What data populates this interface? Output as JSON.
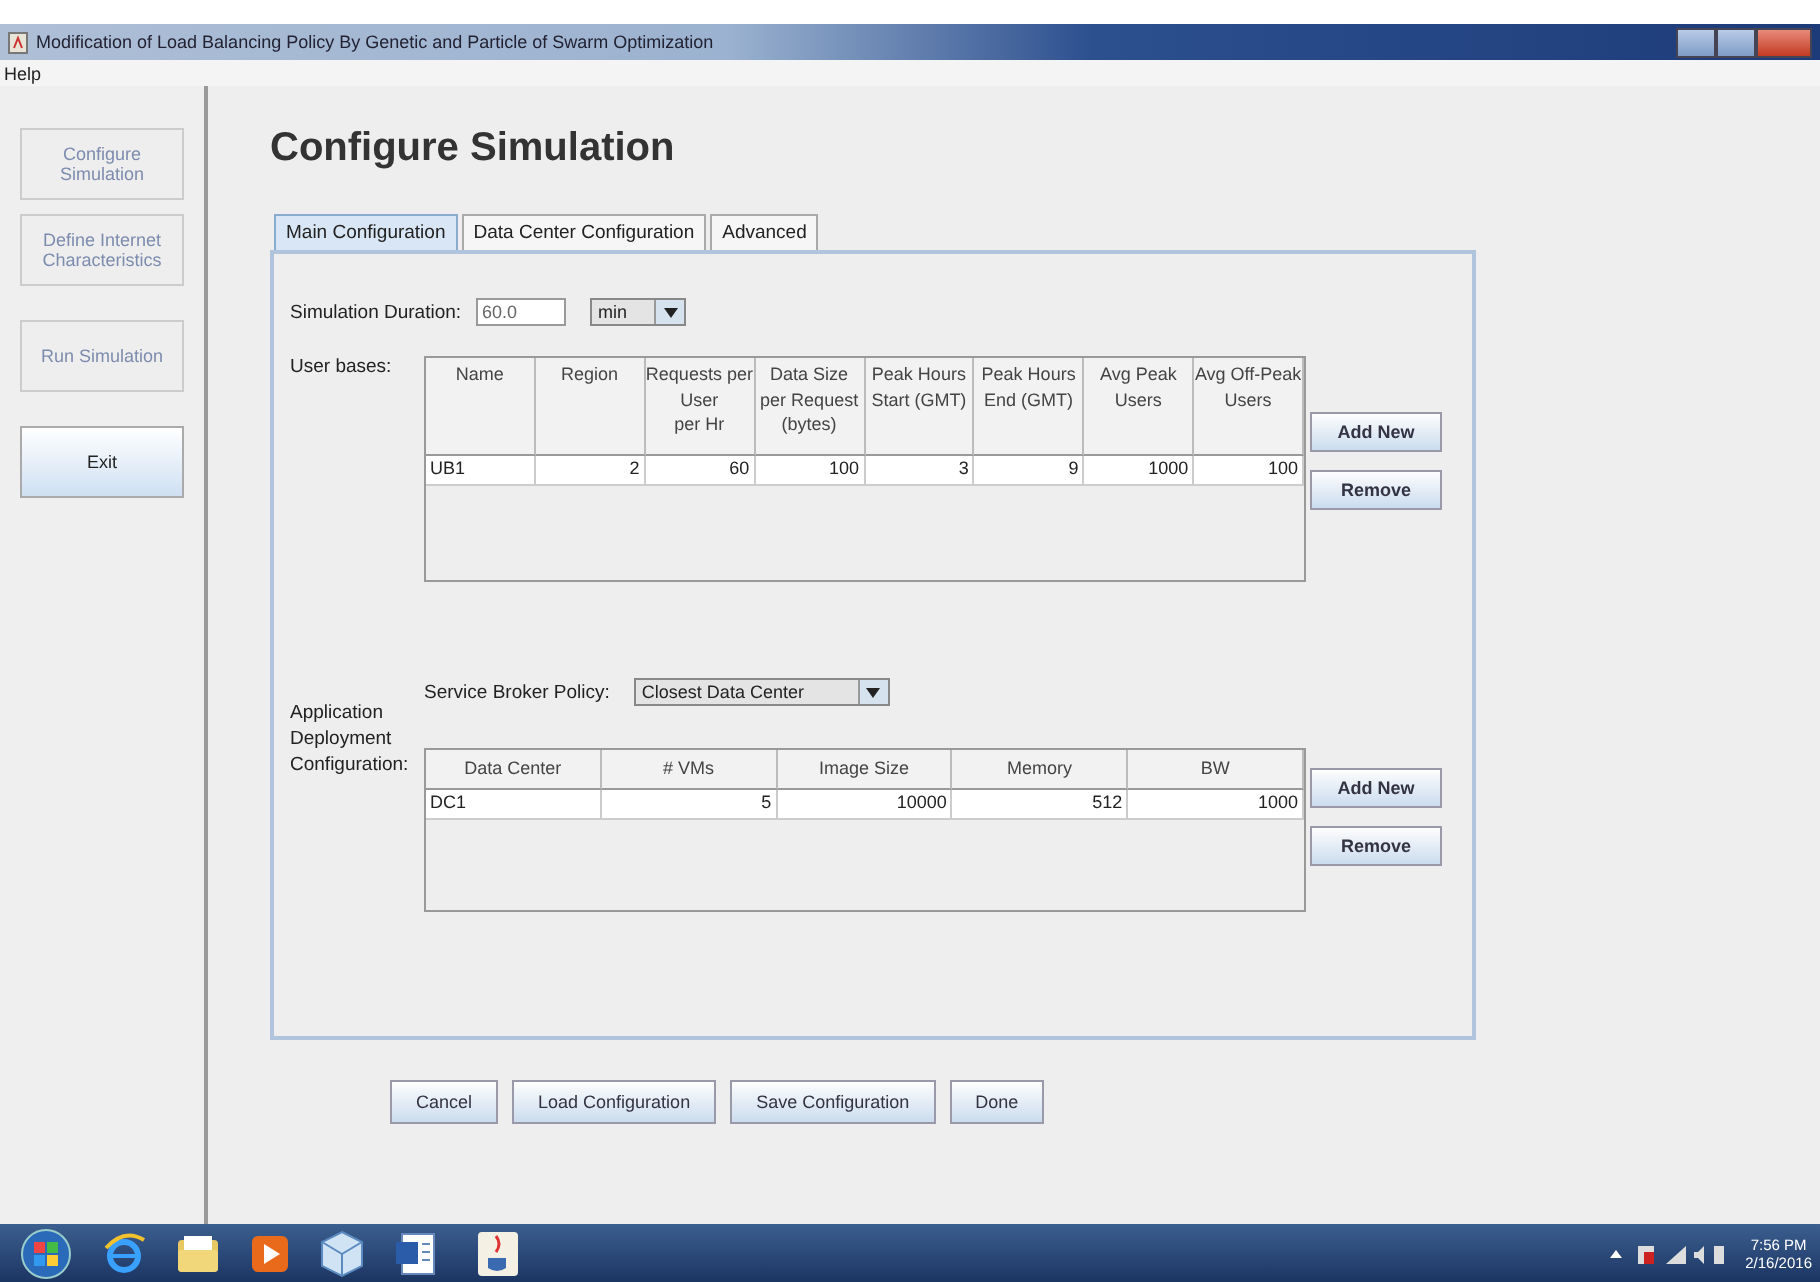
{
  "window": {
    "title": "Modification of Load Balancing Policy By Genetic and Particle of Swarm Optimization"
  },
  "menu": [
    "Help"
  ],
  "sidebar": {
    "buttons": [
      {
        "label": "Configure\nSimulation",
        "disabled": true
      },
      {
        "label": "Define Internet\nCharacteristics",
        "disabled": true
      },
      {
        "label": "Run Simulation",
        "disabled": true
      },
      {
        "label": "Exit",
        "disabled": false
      }
    ]
  },
  "heading": "Configure Simulation",
  "tabs": [
    {
      "label": "Main Configuration",
      "selected": true
    },
    {
      "label": "Data Center Configuration",
      "selected": false
    },
    {
      "label": "Advanced",
      "selected": false
    }
  ],
  "simulation_duration": {
    "label": "Simulation Duration:",
    "value": "60.0",
    "unit": "min"
  },
  "user_bases": {
    "label": "User bases:",
    "columns": [
      "Name",
      "Region",
      "Requests per\nUser\nper Hr",
      "Data Size\nper Request\n(bytes)",
      "Peak Hours\nStart (GMT)",
      "Peak Hours\nEnd (GMT)",
      "Avg Peak\nUsers",
      "Avg Off-Peak\nUsers"
    ],
    "rows": [
      [
        "UB1",
        "2",
        "60",
        "100",
        "3",
        "9",
        "1000",
        "100"
      ]
    ],
    "buttons": [
      "Add New",
      "Remove"
    ]
  },
  "application_deployment": {
    "label": "Application\nDeployment\nConfiguration:",
    "service_broker_policy": {
      "label": "Service Broker Policy:",
      "value": "Closest Data Center"
    },
    "columns": [
      "Data Center",
      "# VMs",
      "Image Size",
      "Memory",
      "BW"
    ],
    "rows": [
      [
        "DC1",
        "5",
        "10000",
        "512",
        "1000"
      ]
    ],
    "buttons": [
      "Add New",
      "Remove"
    ]
  },
  "footer_buttons": [
    "Cancel",
    "Load Configuration",
    "Save Configuration",
    "Done"
  ],
  "taskbar": {
    "time": "7:56 PM",
    "date": "2/16/2016"
  }
}
